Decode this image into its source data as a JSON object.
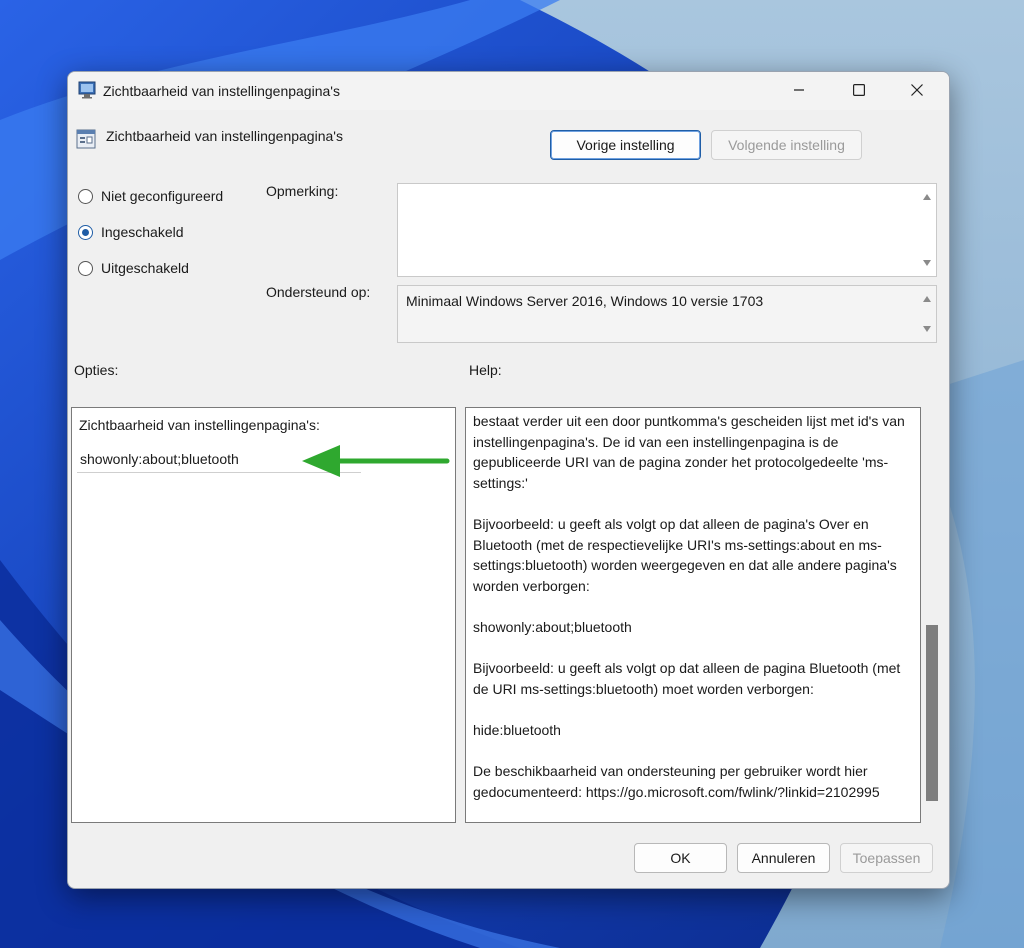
{
  "window": {
    "title": "Zichtbaarheid van instellingenpagina's"
  },
  "policy": {
    "title": "Zichtbaarheid van instellingenpagina's",
    "prev_label": "Vorige instelling",
    "next_label": "Volgende instelling"
  },
  "state": {
    "options": [
      {
        "label": "Niet geconfigureerd",
        "checked": false
      },
      {
        "label": "Ingeschakeld",
        "checked": true
      },
      {
        "label": "Uitgeschakeld",
        "checked": false
      }
    ]
  },
  "comment": {
    "label": "Opmerking:",
    "value": ""
  },
  "supported": {
    "label": "Ondersteund op:",
    "value": "Minimaal Windows Server 2016, Windows 10 versie 1703"
  },
  "options_section": {
    "label": "Opties:",
    "field_label": "Zichtbaarheid van instellingenpagina's:",
    "field_value": "showonly:about;bluetooth"
  },
  "help_section": {
    "label": "Help:",
    "paragraphs": [
      "bestaat verder uit een door puntkomma's gescheiden lijst met id's van instellingenpagina's. De id van een instellingenpagina is de gepubliceerde URI van de pagina zonder het protocolgedeelte 'ms-settings:'",
      "Bijvoorbeeld: u geeft als volgt op dat alleen de pagina's Over en Bluetooth (met de respectievelijke URI's ms-settings:about en ms-settings:bluetooth) worden weergegeven en dat alle andere pagina's worden verborgen:",
      "showonly:about;bluetooth",
      "Bijvoorbeeld: u geeft als volgt op dat alleen de pagina Bluetooth (met de URI ms-settings:bluetooth) moet worden verborgen:",
      "hide:bluetooth",
      "De beschikbaarheid van ondersteuning per gebruiker wordt hier gedocumenteerd: https://go.microsoft.com/fwlink/?linkid=2102995"
    ]
  },
  "footer": {
    "ok_label": "OK",
    "cancel_label": "Annuleren",
    "apply_label": "Toepassen"
  },
  "colors": {
    "accent": "#1f5da6",
    "arrow": "#2fa82f",
    "wallpaper": "#1d4fd0"
  }
}
